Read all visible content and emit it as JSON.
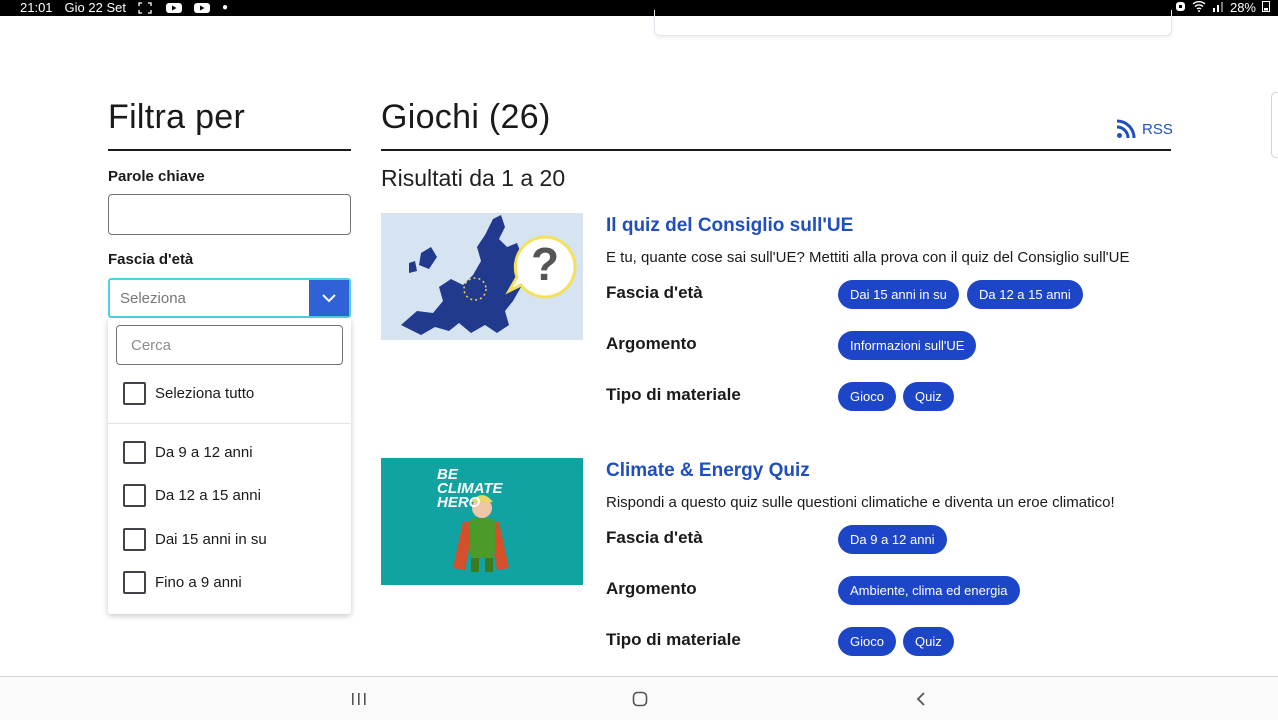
{
  "status_bar": {
    "time": "21:01",
    "date": "Gio 22 Set",
    "battery": "28%",
    "icons": [
      "screenshot-icon",
      "youtube-icon",
      "youtube-icon",
      "dot-icon",
      "alarm-icon",
      "wifi-icon",
      "signal-icon",
      "battery-icon"
    ]
  },
  "filter": {
    "title": "Filtra per",
    "keywords_label": "Parole chiave",
    "keywords_value": "",
    "age_label": "Fascia d'età",
    "age_placeholder": "Seleziona",
    "dropdown": {
      "search_placeholder": "Cerca",
      "select_all": "Seleziona tutto",
      "options": [
        {
          "label": "Da 9 a 12 anni",
          "checked": false
        },
        {
          "label": "Da 12 a 15 anni",
          "checked": false
        },
        {
          "label": "Dai 15 anni in su",
          "checked": false
        },
        {
          "label": "Fino a 9 anni",
          "checked": false
        }
      ]
    }
  },
  "results": {
    "title": "Giochi (26)",
    "rss_label": "RSS",
    "count_text": "Risultati da 1 a 20",
    "meta_labels": {
      "age": "Fascia d'età",
      "topic": "Argomento",
      "type": "Tipo di materiale"
    },
    "items": [
      {
        "title": "Il quiz del Consiglio sull'UE",
        "description": "E tu, quante cose sai sull'UE? Mettiti alla prova con il quiz del Consiglio sull'UE",
        "thumb_text": "?",
        "age_tags": [
          "Dai 15 anni in su",
          "Da 12 a 15 anni"
        ],
        "topic_tags": [
          "Informazioni sull'UE"
        ],
        "type_tags": [
          "Gioco",
          "Quiz"
        ]
      },
      {
        "title": "Climate & Energy Quiz",
        "description": "Rispondi a questo quiz sulle questioni climatiche e diventa un eroe climatico!",
        "thumb_text": "BE CLIMATE HERO",
        "age_tags": [
          "Da 9 a 12 anni"
        ],
        "topic_tags": [
          "Ambiente, clima ed energia"
        ],
        "type_tags": [
          "Gioco",
          "Quiz"
        ]
      }
    ]
  },
  "colors": {
    "link": "#1f4fbf",
    "tag": "#1d45c8",
    "select_button": "#2e62d6",
    "focus_border": "#4fd2e5"
  }
}
